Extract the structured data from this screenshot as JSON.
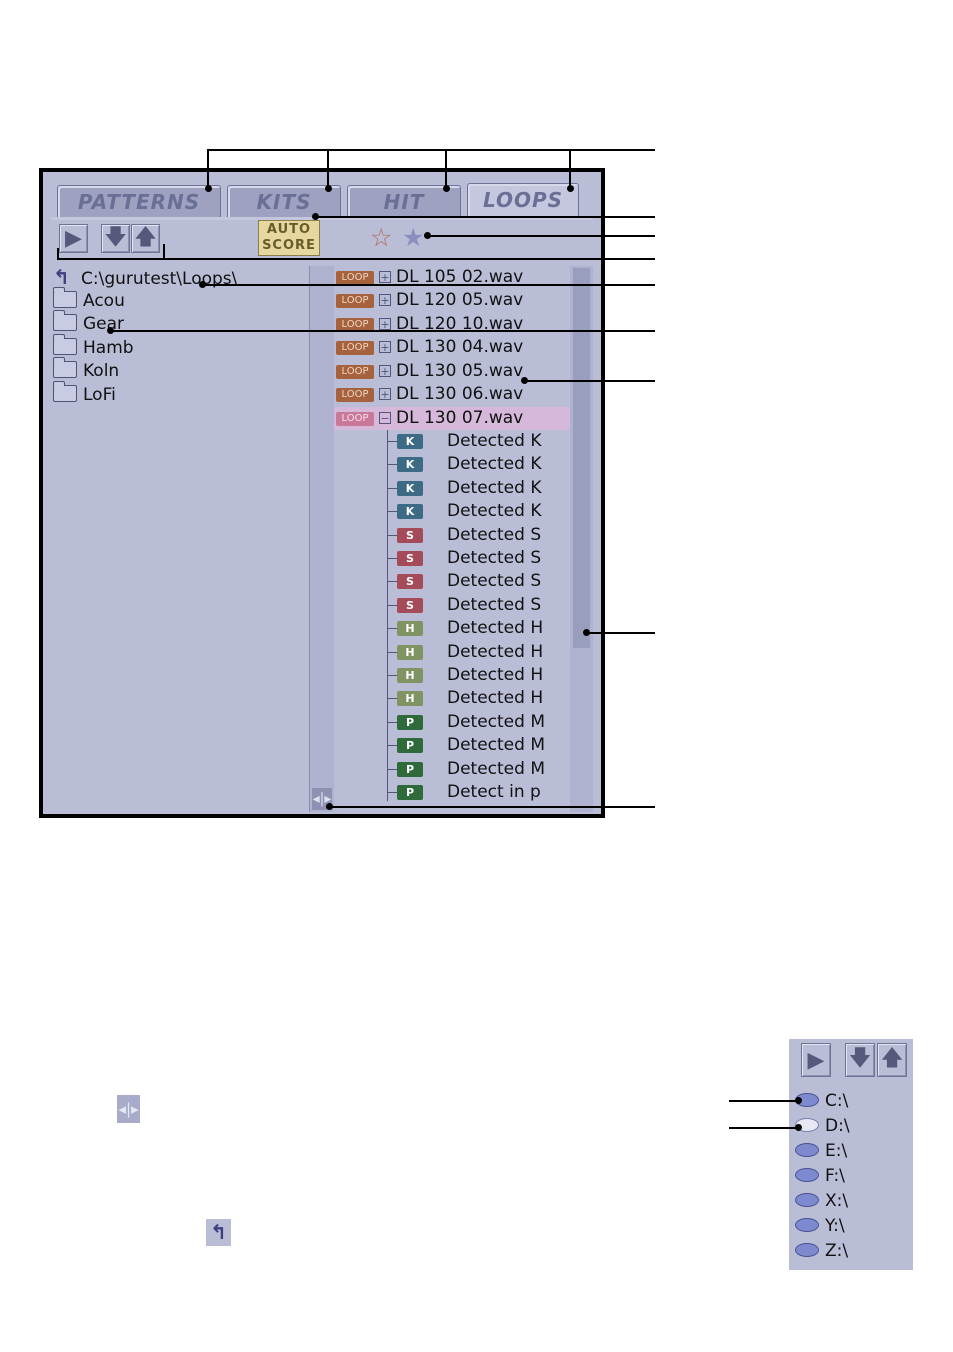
{
  "tabs": [
    {
      "label": "PATTERNS",
      "active": false
    },
    {
      "label": "KITS",
      "active": false
    },
    {
      "label": "HIT",
      "active": false
    },
    {
      "label": "LOOPS",
      "active": true
    }
  ],
  "toolbar": {
    "play_icon": "play-icon",
    "down_icon": "arrow-down-icon",
    "up_icon": "arrow-up-icon",
    "autoscore_line1": "AUTO",
    "autoscore_line2": "SCORE",
    "star_outline_icon": "star-outline-icon",
    "star_filled_icon": "star-filled-icon"
  },
  "folders": {
    "path": "C:\\gurutest\\Loops\\",
    "items": [
      "Acou",
      "Gear",
      "Hamb",
      "Koln",
      "LoFi"
    ]
  },
  "loops": {
    "badge": "LOOP",
    "items": [
      {
        "name": "DL  105  02.wav",
        "expanded": false,
        "selected": false
      },
      {
        "name": "DL  120  05.wav",
        "expanded": false,
        "selected": false
      },
      {
        "name": "DL  120  10.wav",
        "expanded": false,
        "selected": false
      },
      {
        "name": "DL  130  04.wav",
        "expanded": false,
        "selected": false
      },
      {
        "name": "DL  130  05.wav",
        "expanded": false,
        "selected": false
      },
      {
        "name": "DL  130  06.wav",
        "expanded": false,
        "selected": false
      },
      {
        "name": "DL  130  07.wav",
        "expanded": true,
        "selected": true
      }
    ],
    "children": [
      {
        "badge": "K",
        "text": "Detected  K",
        "color": "#3d6b86"
      },
      {
        "badge": "K",
        "text": "Detected  K",
        "color": "#3d6b86"
      },
      {
        "badge": "K",
        "text": "Detected  K",
        "color": "#3d6b86"
      },
      {
        "badge": "K",
        "text": "Detected  K",
        "color": "#3d6b86"
      },
      {
        "badge": "S",
        "text": "Detected  S",
        "color": "#a44a58"
      },
      {
        "badge": "S",
        "text": "Detected  S",
        "color": "#a44a58"
      },
      {
        "badge": "S",
        "text": "Detected  S",
        "color": "#a44a58"
      },
      {
        "badge": "S",
        "text": "Detected  S",
        "color": "#a44a58"
      },
      {
        "badge": "H",
        "text": "Detected  H",
        "color": "#7f9462"
      },
      {
        "badge": "H",
        "text": "Detected  H",
        "color": "#7f9462"
      },
      {
        "badge": "H",
        "text": "Detected  H",
        "color": "#7f9462"
      },
      {
        "badge": "H",
        "text": "Detected  H",
        "color": "#7f9462"
      },
      {
        "badge": "P",
        "text": "Detected  M",
        "color": "#2f6a3b"
      },
      {
        "badge": "P",
        "text": "Detected  M",
        "color": "#2f6a3b"
      },
      {
        "badge": "P",
        "text": "Detected  M",
        "color": "#2f6a3b"
      },
      {
        "badge": "P",
        "text": "Detect  in  p",
        "color": "#2f6a3b"
      }
    ]
  },
  "drives": [
    "C:\\",
    "D:\\",
    "E:\\",
    "F:\\",
    "X:\\",
    "Y:\\",
    "Z:\\"
  ],
  "icons": {
    "splitter_grip": "splitter-grip-icon",
    "up_folder": "up-folder-icon"
  }
}
